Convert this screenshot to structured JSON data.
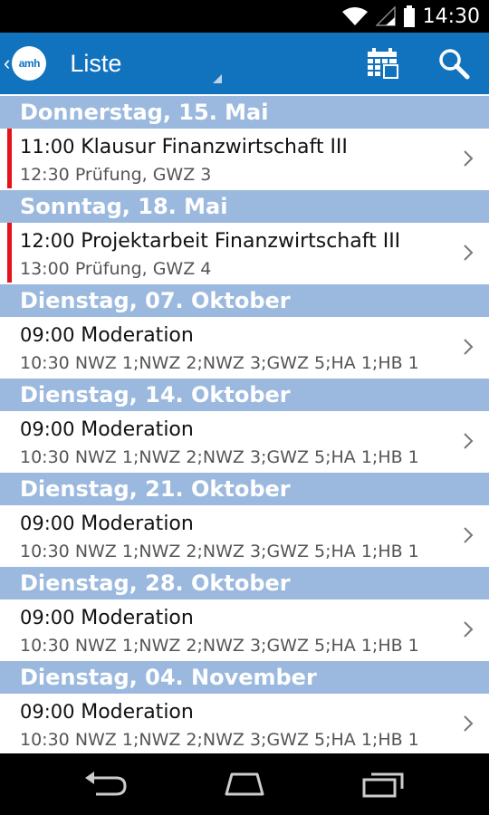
{
  "status_bar": {
    "time": "14:30",
    "icons": [
      "wifi-icon",
      "signal-icon",
      "battery-icon"
    ]
  },
  "action_bar": {
    "logo_text": "amh",
    "view_label": "Liste",
    "actions": [
      "calendar-icon",
      "search-icon"
    ],
    "color": "#1173be"
  },
  "colors": {
    "section_header_bg": "#9bb9de",
    "marker": "#e3141b"
  },
  "sections": [
    {
      "header": "Donnerstag, 15. Mai",
      "item": {
        "start": "11:00",
        "title": "Klausur Finanzwirtschaft III",
        "end": "12:30",
        "detail": "Prüfung, GWZ 3",
        "marked": true
      }
    },
    {
      "header": "Sonntag, 18. Mai",
      "item": {
        "start": "12:00",
        "title": "Projektarbeit Finanzwirtschaft III",
        "end": "13:00",
        "detail": "Prüfung, GWZ 4",
        "marked": true
      }
    },
    {
      "header": "Dienstag, 07. Oktober",
      "item": {
        "start": "09:00",
        "title": "Moderation",
        "end": "10:30",
        "detail": "NWZ 1;NWZ 2;NWZ 3;GWZ 5;HA 1;HB 1",
        "marked": false
      }
    },
    {
      "header": "Dienstag, 14. Oktober",
      "item": {
        "start": "09:00",
        "title": "Moderation",
        "end": "10:30",
        "detail": "NWZ 1;NWZ 2;NWZ 3;GWZ 5;HA 1;HB 1",
        "marked": false
      }
    },
    {
      "header": "Dienstag, 21. Oktober",
      "item": {
        "start": "09:00",
        "title": "Moderation",
        "end": "10:30",
        "detail": "NWZ 1;NWZ 2;NWZ 3;GWZ 5;HA 1;HB 1",
        "marked": false
      }
    },
    {
      "header": "Dienstag, 28. Oktober",
      "item": {
        "start": "09:00",
        "title": "Moderation",
        "end": "10:30",
        "detail": "NWZ 1;NWZ 2;NWZ 3;GWZ 5;HA 1;HB 1",
        "marked": false
      }
    },
    {
      "header": "Dienstag, 04. November",
      "item": {
        "start": "09:00",
        "title": "Moderation",
        "end": "10:30",
        "detail": "NWZ 1;NWZ 2;NWZ 3;GWZ 5;HA 1;HB 1",
        "marked": false
      }
    }
  ],
  "nav_bar": {
    "buttons": [
      "back-icon",
      "home-icon",
      "recent-apps-icon"
    ]
  }
}
